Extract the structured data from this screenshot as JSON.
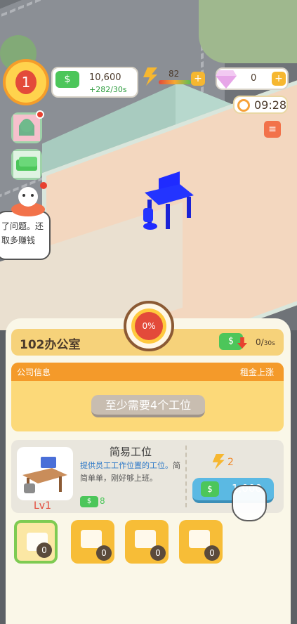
{
  "hud": {
    "level": "1",
    "money": {
      "icon": "cash-icon",
      "symbol": "$",
      "value": "10,600",
      "rate": "+282/30s"
    },
    "energy": {
      "icon": "lightning-icon",
      "value": "82"
    },
    "gems": {
      "icon": "diamond-icon",
      "value": "0"
    },
    "timer": "09:28"
  },
  "bubble_text": "了问题。还\n取多赚钱",
  "room": {
    "title": "102办公室",
    "progress": "0%",
    "rate_value": "0/",
    "rate_unit": "30s"
  },
  "company": {
    "header_left": "公司信息",
    "header_right": "租金上涨",
    "need_label": "至少需要4个工位"
  },
  "item": {
    "name": "简易工位",
    "desc_highlight": "提供员工工作位置的工位。",
    "desc_rest": "简简单单，刚好够上班。",
    "level": "Lv1",
    "income": "8",
    "energy_cost": "2",
    "price": "1,000",
    "symbol": "$"
  },
  "slots": [
    {
      "count": "0"
    },
    {
      "count": "0"
    },
    {
      "count": "0"
    },
    {
      "count": "0"
    }
  ],
  "colors": {
    "accent": "#f49a2a",
    "cash": "#4cc65a",
    "buy": "#5bb9e3",
    "highlight_desk": "#1f2bff"
  }
}
